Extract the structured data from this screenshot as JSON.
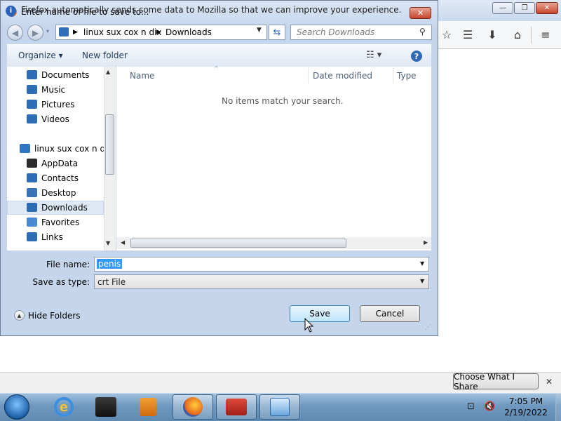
{
  "dialog": {
    "title": "Enter name of file to save to...",
    "close_label": "✕",
    "address": {
      "crumbs": [
        "linux sux cox n dix",
        "Downloads"
      ]
    },
    "search": {
      "placeholder": "Search Downloads"
    },
    "commands": {
      "organize": "Organize ▾",
      "new_folder": "New folder"
    },
    "nav_items": [
      {
        "label": "Documents",
        "color": "#2d6db5"
      },
      {
        "label": "Music",
        "color": "#2d6db5"
      },
      {
        "label": "Pictures",
        "color": "#2d6db5"
      },
      {
        "label": "Videos",
        "color": "#2d6db5"
      },
      {
        "label": "linux sux cox n dix",
        "color": "#2f76c2"
      },
      {
        "label": "AppData",
        "color": "#2b2b2b"
      },
      {
        "label": "Contacts",
        "color": "#2d6db5"
      },
      {
        "label": "Desktop",
        "color": "#3a74b8"
      },
      {
        "label": "Downloads",
        "color": "#2d6db5"
      },
      {
        "label": "Favorites",
        "color": "#4a8ad0"
      },
      {
        "label": "Links",
        "color": "#2d6db5"
      }
    ],
    "columns": {
      "name": "Name",
      "date_modified": "Date modified",
      "type": "Type"
    },
    "empty_message": "No items match your search.",
    "file_name": {
      "label": "File name:",
      "value": "penis"
    },
    "save_as_type": {
      "label": "Save as type:",
      "value": "crt File"
    },
    "hide_folders": "Hide Folders",
    "save_button": "Save",
    "cancel_button": "Cancel"
  },
  "notification": {
    "text": "Firefox automatically sends some data to Mozilla so that we can improve your experience.",
    "button": "Choose What I Share",
    "close": "✕"
  },
  "taskbar": {
    "time": "7:05 PM",
    "date": "2/19/2022"
  }
}
